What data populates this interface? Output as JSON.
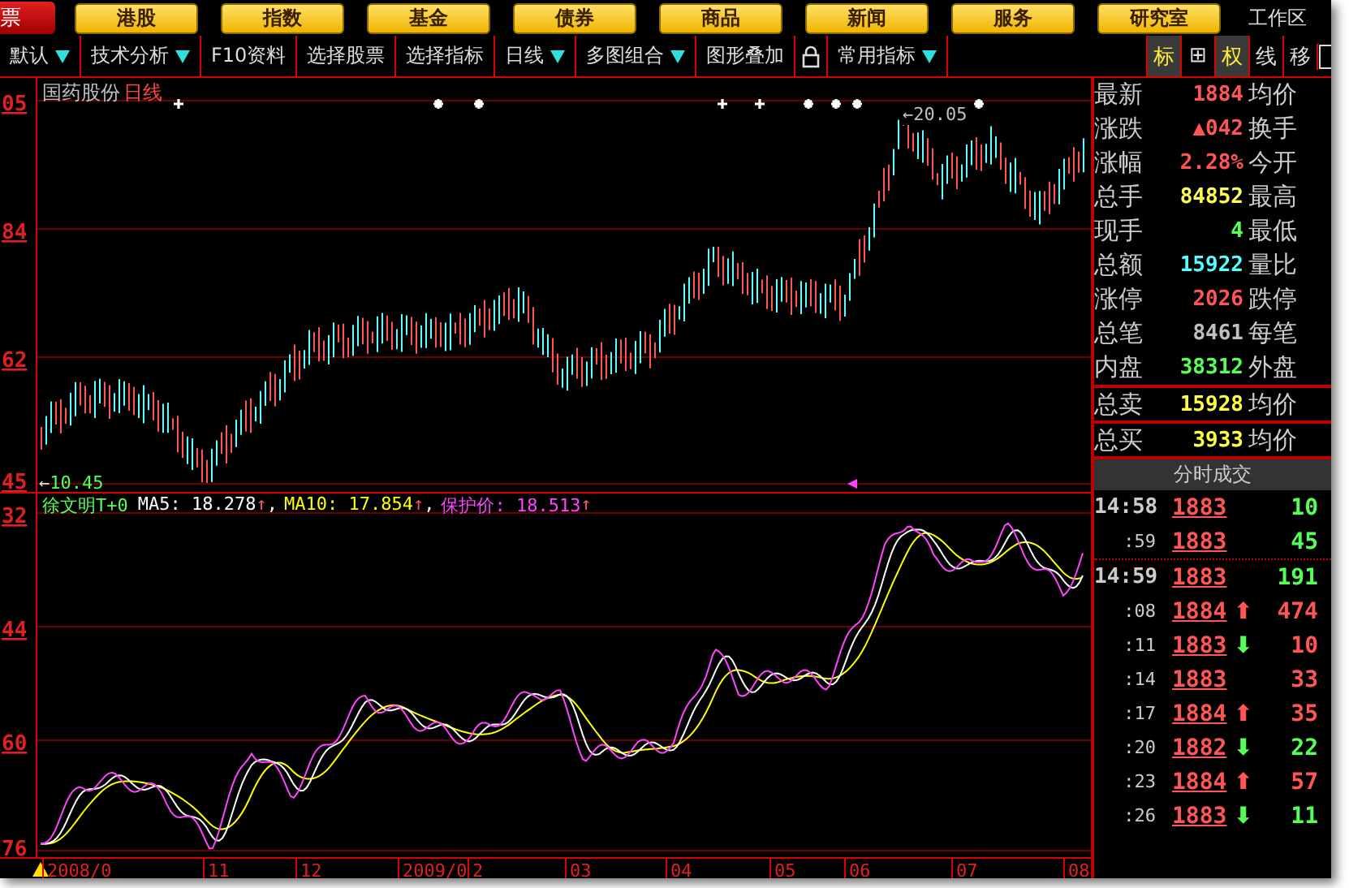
{
  "nav": {
    "left_tab": "票",
    "buttons": [
      "港股",
      "指数",
      "基金",
      "债券",
      "商品",
      "新闻",
      "服务",
      "研究室"
    ],
    "workspace": "工作区"
  },
  "toolbar": {
    "items": [
      {
        "kind": "text",
        "label": "默认",
        "dropdown": true
      },
      {
        "kind": "text",
        "label": "技术分析",
        "dropdown": true
      },
      {
        "kind": "text",
        "label": "F10资料",
        "dropdown": false
      },
      {
        "kind": "text",
        "label": "选择股票",
        "dropdown": false
      },
      {
        "kind": "text",
        "label": "选择指标",
        "dropdown": false
      },
      {
        "kind": "text",
        "label": "日线",
        "dropdown": true
      },
      {
        "kind": "text",
        "label": "多图组合",
        "dropdown": true
      },
      {
        "kind": "text",
        "label": "图形叠加",
        "dropdown": false
      },
      {
        "kind": "lock"
      },
      {
        "kind": "text",
        "label": "常用指标",
        "dropdown": true
      }
    ],
    "right_tools": [
      {
        "label": "标",
        "selected": true
      },
      {
        "label": "⊞",
        "selected": false
      },
      {
        "label": "权",
        "selected": true
      },
      {
        "label": "线",
        "selected": false
      },
      {
        "label": "移",
        "selected": false
      }
    ]
  },
  "price_chart": {
    "title": "国药股份",
    "period": "日线",
    "y_labels": [
      "05",
      "84",
      "62",
      "45"
    ],
    "high_label": "←20.05",
    "low_arrow": "←",
    "low_value": "10.45"
  },
  "indicator_chart": {
    "name": "徐文明T+0",
    "legend": [
      {
        "text": "MA5: 18.278",
        "arrow": "↑",
        "sep": ",",
        "color": "#ffffff"
      },
      {
        "text": "MA10: 17.854",
        "arrow": "↑",
        "sep": ",",
        "color": "#ffff00"
      },
      {
        "text": "保护价: 18.513",
        "arrow": "↑",
        "color": "#ff44ff"
      }
    ],
    "y_labels": [
      "32",
      "44",
      "60",
      "76"
    ]
  },
  "x_axis": {
    "labels": [
      "2008/0",
      "11",
      "12",
      "2009/0",
      "2",
      "03",
      "04",
      "05",
      "06",
      "07",
      "08"
    ]
  },
  "quote": {
    "rows": [
      {
        "label": "最新",
        "value": "1884",
        "color": "#ff5555",
        "label2": "均价"
      },
      {
        "label": "涨跌",
        "value": "▲042",
        "color": "#ff5555",
        "label2": "换手"
      },
      {
        "label": "涨幅",
        "value": "2.28%",
        "color": "#ff5555",
        "label2": "今开"
      },
      {
        "label": "总手",
        "value": "84852",
        "color": "#ffff55",
        "label2": "最高"
      },
      {
        "label": "现手",
        "value": "4",
        "color": "#55ff55",
        "label2": "最低"
      },
      {
        "label": "总额",
        "value": "15922",
        "color": "#55ffff",
        "label2": "量比"
      },
      {
        "label": "涨停",
        "value": "2026",
        "color": "#ff5555",
        "label2": "跌停"
      },
      {
        "label": "总笔",
        "value": "8461",
        "color": "#c0c0c0",
        "label2": "每笔"
      },
      {
        "label": "内盘",
        "value": "38312",
        "color": "#55ff55",
        "label2": "外盘"
      }
    ],
    "book": [
      {
        "label": "总卖",
        "value": "15928",
        "color": "#ffff44",
        "label2": "均价"
      },
      {
        "label": "总买",
        "value": "3933",
        "color": "#ffff44",
        "label2": "均价"
      }
    ]
  },
  "trades": {
    "title": "分时成交",
    "rows": [
      {
        "kind": "minute",
        "time": "14:58",
        "price": "1883",
        "volume": "10",
        "color": "#55ff55"
      },
      {
        "kind": "second",
        "time": ":59",
        "price": "1883",
        "volume": "45",
        "color": "#55ff55"
      },
      {
        "kind": "minute",
        "time": "14:59",
        "price": "1883",
        "volume": "191",
        "color": "#55ff55"
      },
      {
        "kind": "second",
        "time": ":08",
        "price": "1884",
        "arrow": {
          "glyph": "⬆",
          "color": "#ff5555"
        },
        "volume": "474",
        "color": "#ff5555"
      },
      {
        "kind": "second",
        "time": ":11",
        "price": "1883",
        "arrow": {
          "glyph": "⬇",
          "color": "#55ff55"
        },
        "volume": "10",
        "color": "#ff5555"
      },
      {
        "kind": "second",
        "time": ":14",
        "price": "1883",
        "volume": "33",
        "color": "#ff5555"
      },
      {
        "kind": "second",
        "time": ":17",
        "price": "1884",
        "arrow": {
          "glyph": "⬆",
          "color": "#ff5555"
        },
        "volume": "35",
        "color": "#ff5555"
      },
      {
        "kind": "second",
        "time": ":20",
        "price": "1882",
        "arrow": {
          "glyph": "⬇",
          "color": "#55ff55"
        },
        "volume": "22",
        "color": "#55ff55"
      },
      {
        "kind": "second",
        "time": ":23",
        "price": "1884",
        "arrow": {
          "glyph": "⬆",
          "color": "#ff5555"
        },
        "volume": "57",
        "color": "#ff5555"
      },
      {
        "kind": "second",
        "time": ":26",
        "price": "1883",
        "arrow": {
          "glyph": "⬇",
          "color": "#55ff55"
        },
        "volume": "11",
        "color": "#55ff55"
      }
    ]
  }
}
